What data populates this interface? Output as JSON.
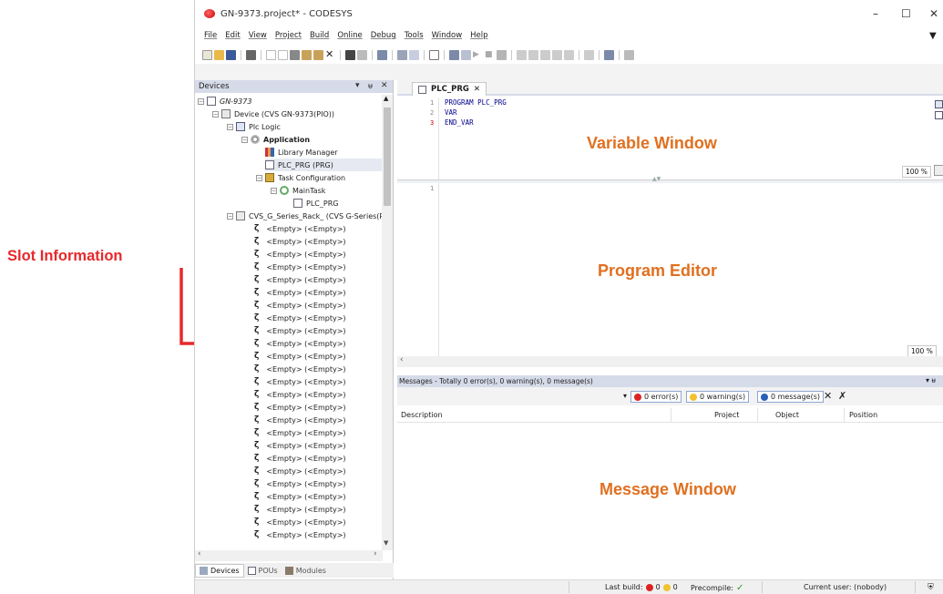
{
  "window": {
    "title": "GN-9373.project* - CODESYS",
    "minimize": "–",
    "maximize": "☐",
    "close": "✕"
  },
  "menu": [
    "File",
    "Edit",
    "View",
    "Project",
    "Build",
    "Online",
    "Debug",
    "Tools",
    "Window",
    "Help"
  ],
  "devices_pane": {
    "title": "Devices",
    "tree": {
      "root": "GN-9373",
      "device": "Device (CVS GN-9373(PIO))",
      "plc_logic": "Plc Logic",
      "application": "Application",
      "library_manager": "Library Manager",
      "plc_prg": "PLC_PRG (PRG)",
      "task_configuration": "Task Configuration",
      "maintask": "MainTask",
      "task_pou": "PLC_PRG",
      "rack": "CVS_G_Series_Rack_ (CVS G-Series(Ra",
      "slot_label": "<Empty> (<Empty>)",
      "slot_count": 25
    },
    "bottom_tabs": [
      "Devices",
      "POUs",
      "Modules"
    ]
  },
  "editor": {
    "tab": "PLC_PRG",
    "variable_window": {
      "lines": [
        {
          "n": "1",
          "text": "PROGRAM PLC_PRG"
        },
        {
          "n": "2",
          "text": "VAR"
        },
        {
          "n": "3",
          "text": "END_VAR"
        }
      ],
      "zoom": "100 %"
    },
    "program_editor": {
      "lines": [
        {
          "n": "1",
          "text": ""
        }
      ],
      "zoom": "100 %"
    }
  },
  "messages": {
    "header": "Messages - Totally 0 error(s), 0 warning(s), 0 message(s)",
    "filters": {
      "errors": "0 error(s)",
      "warnings": "0 warning(s)",
      "messages": "0 message(s)"
    },
    "columns": [
      "Description",
      "Project",
      "Object",
      "Position"
    ]
  },
  "statusbar": {
    "last_build_label": "Last build:",
    "err_count": "0",
    "warn_count": "0",
    "precompile_label": "Precompile:",
    "precompile_mark": "✓",
    "current_user": "Current user: (nobody)"
  },
  "annotations": {
    "variable_window": "Variable Window",
    "program_editor": "Program Editor",
    "message_window": "Message Window",
    "slot_information": "Slot Information"
  },
  "colors": {
    "accent": "#d6dbe9",
    "callout": "#e07020",
    "arrow": "#e8282b",
    "keyword": "#00008b"
  }
}
